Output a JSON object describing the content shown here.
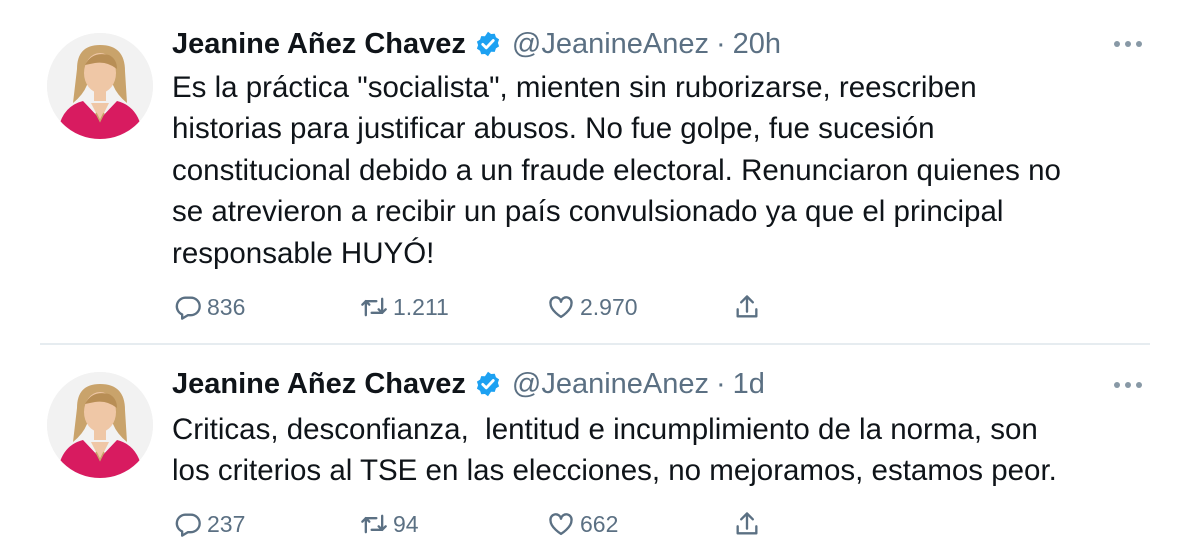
{
  "tweets": [
    {
      "author_name": "Jeanine Añez Chavez",
      "handle": "@JeanineAnez",
      "separator": "·",
      "time": "20h",
      "text_lines": [
        "Es la práctica \"socialista\", mienten sin ruborizarse, reescriben",
        "historias para justificar abusos. No fue golpe, fue sucesión",
        "constitucional debido a un fraude electoral. Renunciaron quienes no",
        "se atrevieron a recibir un país convulsionado ya que el principal",
        "responsable HUYÓ!"
      ],
      "replies": "836",
      "retweets": "1.211",
      "likes": "2.970"
    },
    {
      "author_name": "Jeanine Añez Chavez",
      "handle": "@JeanineAnez",
      "separator": "·",
      "time": "1d",
      "text_lines": [
        "Criticas, desconfianza,  lentitud e incumplimiento de la norma, son",
        "los criterios al TSE en las elecciones, no mejoramos, estamos peor."
      ],
      "replies": "237",
      "retweets": "94",
      "likes": "662"
    }
  ],
  "icons": {
    "verified": "verified-badge-icon",
    "more": "more-horizontal-icon",
    "reply": "reply-bubble-icon",
    "retweet": "retweet-icon",
    "like": "heart-icon",
    "share": "share-upload-icon"
  },
  "colors": {
    "text": "#0f1419",
    "secondary": "#5b7083",
    "verified_blue": "#1da1f2",
    "divider": "#e6ecf0",
    "avatar_blazer": "#d81b60"
  }
}
